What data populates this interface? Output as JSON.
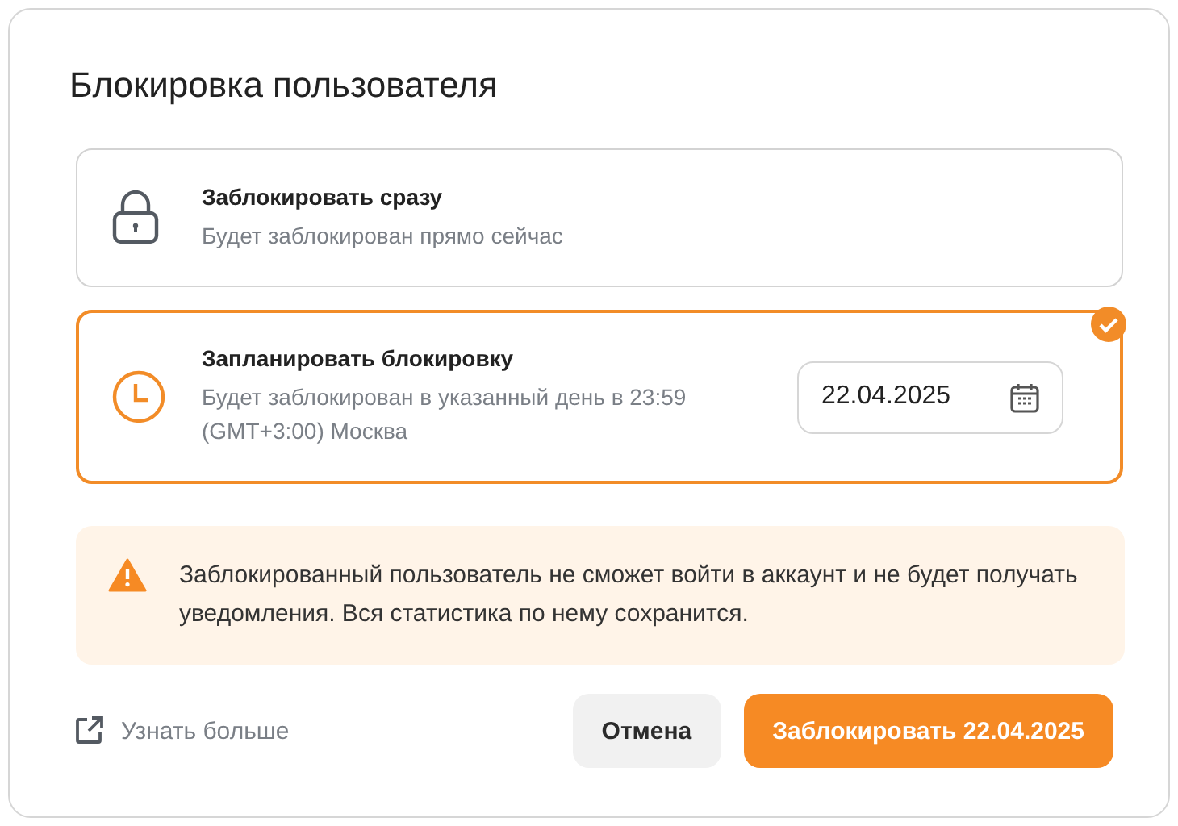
{
  "dialog": {
    "title": "Блокировка пользователя"
  },
  "options": [
    {
      "kind": "lock",
      "title": "Заблокировать сразу",
      "description": "Будет заблокирован прямо сейчас",
      "selected": false
    },
    {
      "kind": "clock",
      "title": "Запланировать блокировку",
      "description": "Будет заблокирован в указанный день в 23:59 (GMT+3:00) Москва",
      "selected": true,
      "date": "22.04.2025"
    }
  ],
  "warning": {
    "text": "Заблокированный пользователь не сможет войти в аккаунт и не будет получать уведомления. Вся статистика по нему сохранится."
  },
  "footer": {
    "link": "Узнать больше",
    "cancel": "Отмена",
    "confirm": "Заблокировать 22.04.2025"
  }
}
